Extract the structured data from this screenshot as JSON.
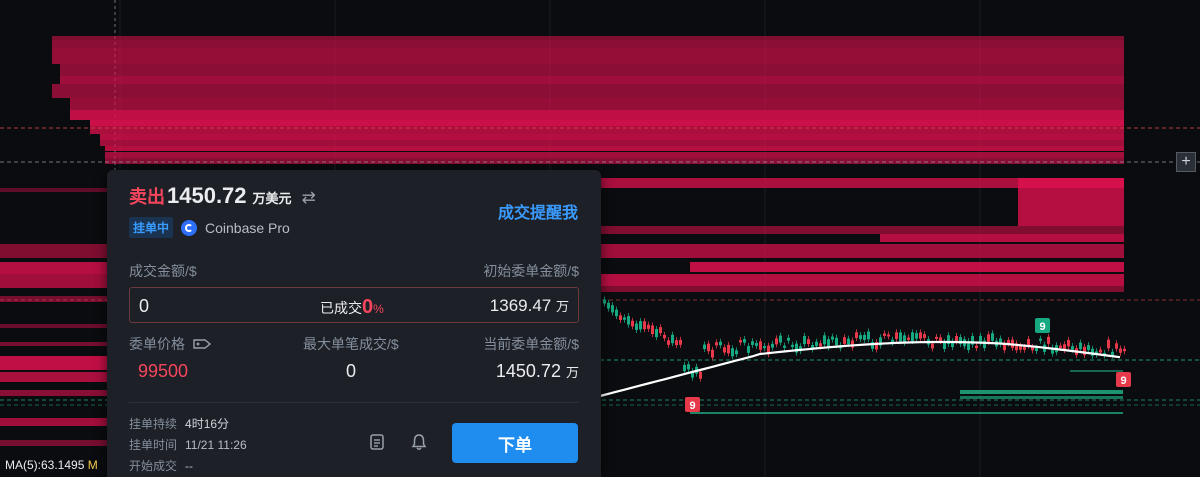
{
  "order": {
    "side_label": "卖出",
    "amount": "1450.72",
    "amount_unit": "万美元",
    "status_badge": "挂单中",
    "exchange": "Coinbase Pro",
    "alert_link": "成交提醒我",
    "filled_amount_label": "成交金额/$",
    "initial_amount_label": "初始委单金额/$",
    "filled_amount_value": "0",
    "filled_pct_label": "已成交",
    "filled_pct_value": "0",
    "filled_pct_unit": "%",
    "initial_amount_value": "1369.47",
    "initial_amount_unit": "万",
    "price_label": "委单价格",
    "max_fill_label": "最大单笔成交/$",
    "current_amount_label": "当前委单金额/$",
    "price_value": "99500",
    "max_fill_value": "0",
    "current_amount_value": "1450.72",
    "current_amount_unit": "万",
    "duration_label": "挂单持续",
    "duration_value": "4时16分",
    "time_label": "挂单时间",
    "time_value": "11/21 11:26",
    "start_label": "开始成交",
    "start_value": "--",
    "submit_label": "下单"
  },
  "chart": {
    "ma_label": "MA(5):63.1495",
    "ma_suffix": "M",
    "marker_labels": [
      "9",
      "9",
      "9"
    ],
    "plus_label": "+",
    "colors": {
      "sell": "#e0104f",
      "buy": "#1fa37a",
      "up": "#16a982",
      "down": "#e6394a",
      "ma": "#ffffff",
      "accent": "#1f8cf0"
    }
  },
  "icons": {
    "swap": "swap-arrows-icon",
    "tag": "tag-icon",
    "note": "note-icon",
    "bell": "bell-icon",
    "exchange": "coinbase-icon"
  }
}
